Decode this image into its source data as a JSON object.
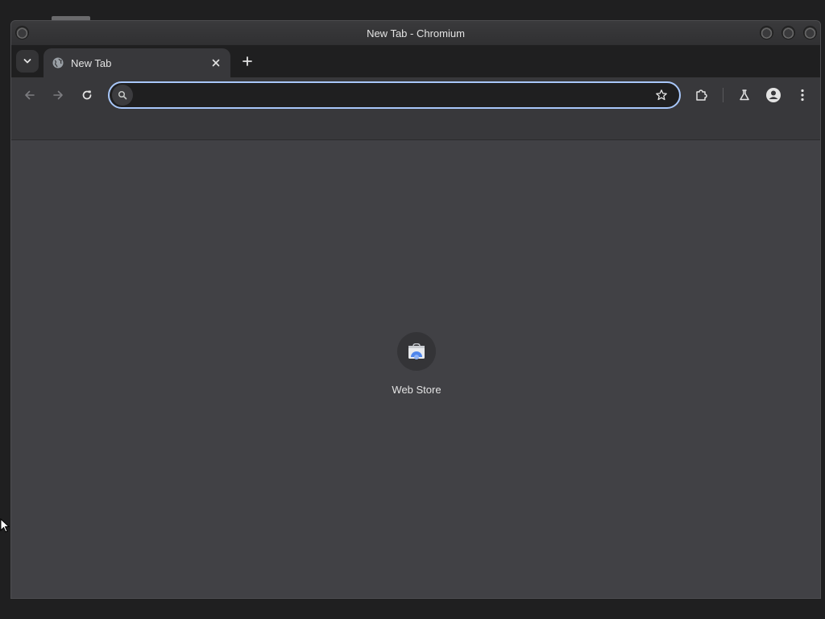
{
  "window": {
    "title": "New Tab - Chromium"
  },
  "tabs": [
    {
      "title": "New Tab",
      "active": true
    }
  ],
  "omnibox": {
    "value": "",
    "placeholder": ""
  },
  "shortcuts": [
    {
      "label": "Web Store",
      "icon": "web-store-icon"
    }
  ],
  "colors": {
    "accent": "#a8c7fa",
    "toolbar": "#38383b",
    "content_bg": "#414145",
    "tabstrip": "#1f1f20",
    "text": "#e3e3e3"
  },
  "icons": {
    "back": "arrow-left-icon",
    "forward": "arrow-right-icon",
    "reload": "reload-icon",
    "search": "search-icon",
    "bookmark": "star-icon",
    "extensions": "puzzle-icon",
    "labs": "flask-icon",
    "profile": "person-icon",
    "menu": "kebab-menu-icon"
  }
}
